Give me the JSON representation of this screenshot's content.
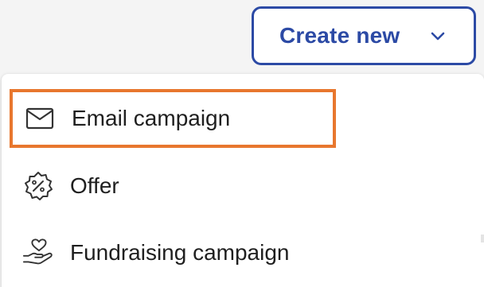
{
  "create_button": {
    "label": "Create new",
    "icon": "chevron-down-icon",
    "color": "#2c4aa5"
  },
  "menu": {
    "highlight_color": "#e8772e",
    "items": [
      {
        "label": "Email campaign",
        "icon": "envelope-icon",
        "highlighted": true
      },
      {
        "label": "Offer",
        "icon": "discount-badge-icon",
        "highlighted": false
      },
      {
        "label": "Fundraising campaign",
        "icon": "heart-hand-icon",
        "highlighted": false
      }
    ]
  }
}
